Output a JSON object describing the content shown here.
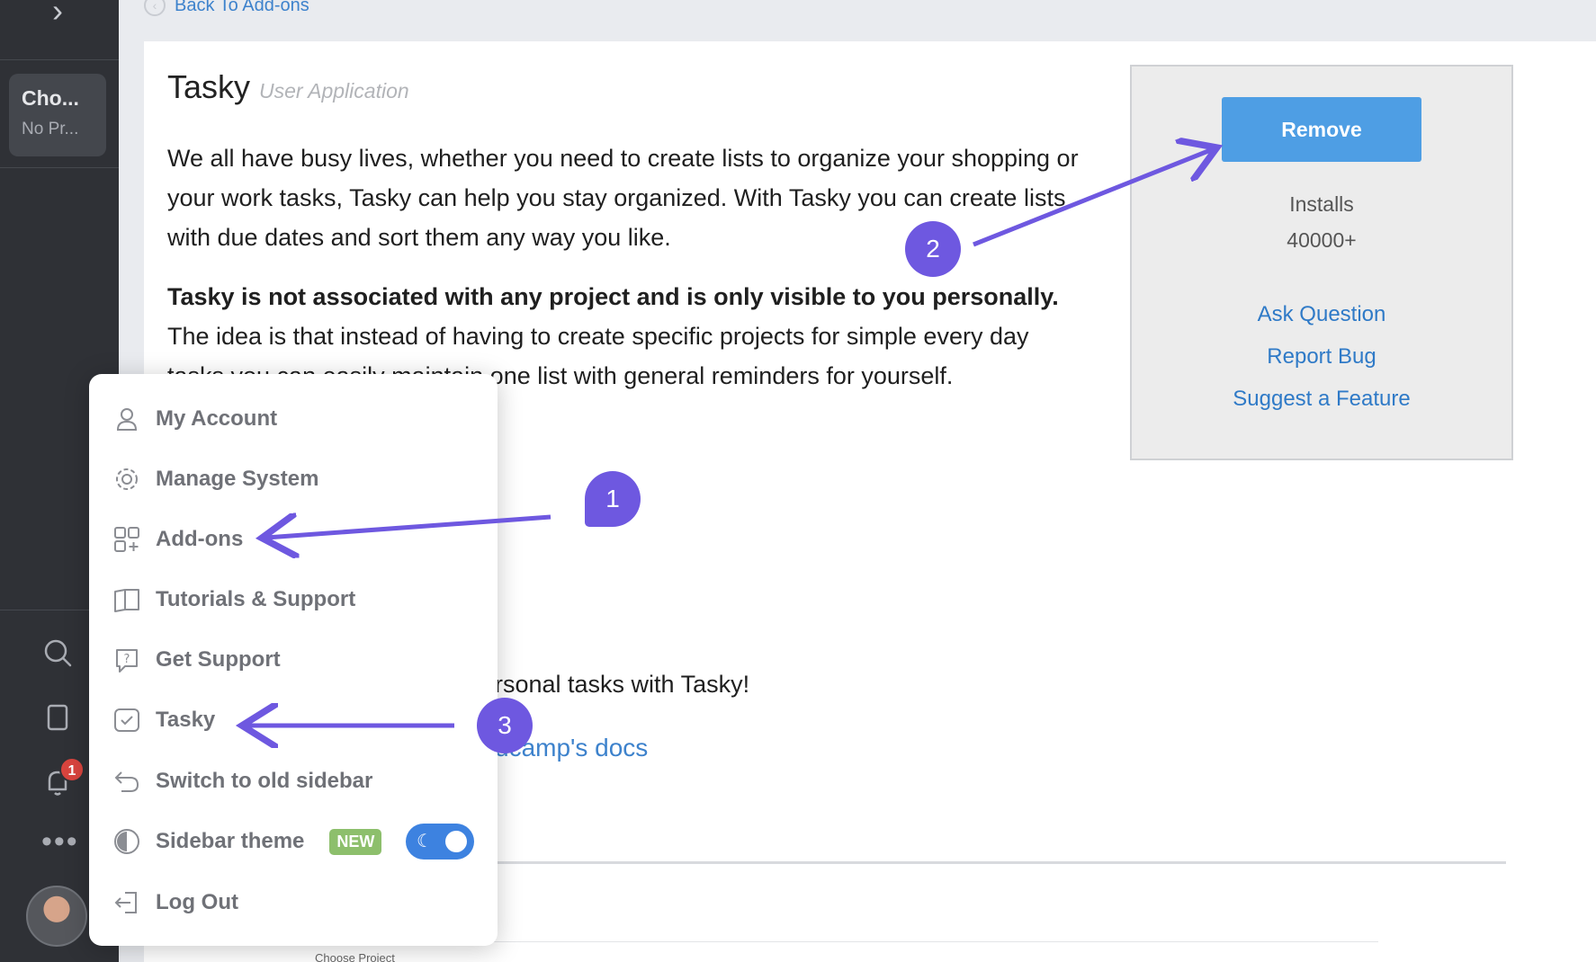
{
  "sidebar": {
    "project_name": "Cho...",
    "project_sub": "No Pr...",
    "notification_count": "1",
    "more_label": "•••"
  },
  "header": {
    "back_label": "Back To Add-ons"
  },
  "addon": {
    "title": "Tasky",
    "type": "User Application",
    "description_1": "We all have busy lives, whether you need to create lists to organize your shopping or your work tasks, Tasky can help you stay organized. With Tasky you can create lists with due dates and sort them any way you like.",
    "description_2_bold": "Tasky is not associated with any project and is only visible to you personally.",
    "description_2_rest": " The idea is that instead of having to create specific projects for simple every day tasks you can easily maintain one list with general reminders for yourself.",
    "tasky_line": "rsonal tasks with Tasky!",
    "docs_link": "dcamp's docs"
  },
  "panel": {
    "remove_label": "Remove",
    "installs_label": "Installs",
    "installs_value": "40000+",
    "ask_question": "Ask Question",
    "report_bug": "Report Bug",
    "suggest_feature": "Suggest a Feature"
  },
  "menu": {
    "items": [
      {
        "label": "My Account",
        "icon": "user-icon"
      },
      {
        "label": "Manage System",
        "icon": "gear-icon"
      },
      {
        "label": "Add-ons",
        "icon": "grid-plus-icon"
      },
      {
        "label": "Tutorials & Support",
        "icon": "book-icon"
      },
      {
        "label": "Get Support",
        "icon": "help-bubble-icon"
      },
      {
        "label": "Tasky",
        "icon": "tasky-icon"
      },
      {
        "label": "Switch to old sidebar",
        "icon": "undo-icon"
      },
      {
        "label": "Sidebar theme",
        "icon": "half-circle-icon"
      },
      {
        "label": "Log Out",
        "icon": "logout-icon"
      }
    ],
    "new_badge": "NEW",
    "theme_toggle_on": true
  },
  "annotations": [
    {
      "number": "1"
    },
    {
      "number": "2"
    },
    {
      "number": "3"
    }
  ],
  "preview": {
    "project": "Choose Project"
  },
  "colors": {
    "accent": "#4e9ee4",
    "annotation": "#6e58e0",
    "sidebar": "#2f3136",
    "link": "#3d82cc",
    "new_badge": "#8dbf6c"
  }
}
